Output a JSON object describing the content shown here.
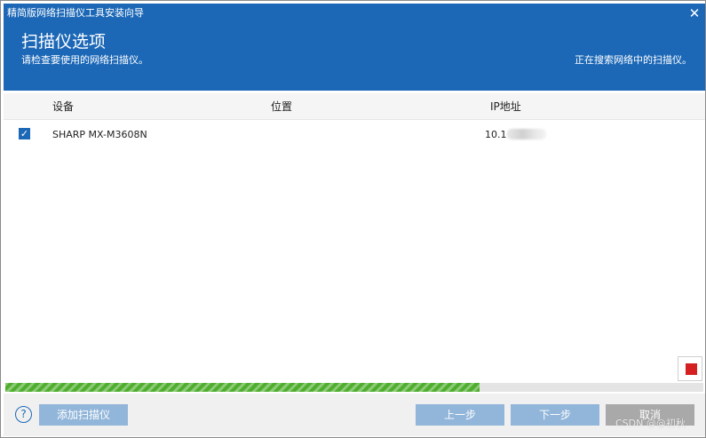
{
  "window": {
    "title": "精简版网络扫描仪工具安装向导",
    "close_glyph": "✕"
  },
  "header": {
    "title": "扫描仪选项",
    "subtitle": "请检查要使用的网络扫描仪。",
    "status": "正在搜索网络中的扫描仪。"
  },
  "table": {
    "columns": [
      "设备",
      "位置",
      "IP地址"
    ],
    "rows": [
      {
        "selected": true,
        "device": "SHARP MX-M3608N",
        "location": "",
        "ip_visible": "10.1"
      }
    ]
  },
  "progress": {
    "fraction": 0.68,
    "color": "#4fae2e"
  },
  "footer": {
    "help_glyph": "?",
    "add_scanner": "添加扫描仪",
    "back": "上一步",
    "next": "下一步",
    "cancel": "取消"
  },
  "watermark": "CSDN @@初秋",
  "colors": {
    "accent": "#1c68b7",
    "stop": "#d42020",
    "button_disabled": "#92b6da"
  },
  "icons": {
    "check": "✓",
    "stop": "stop-icon",
    "help": "help-icon",
    "close": "close-icon"
  }
}
